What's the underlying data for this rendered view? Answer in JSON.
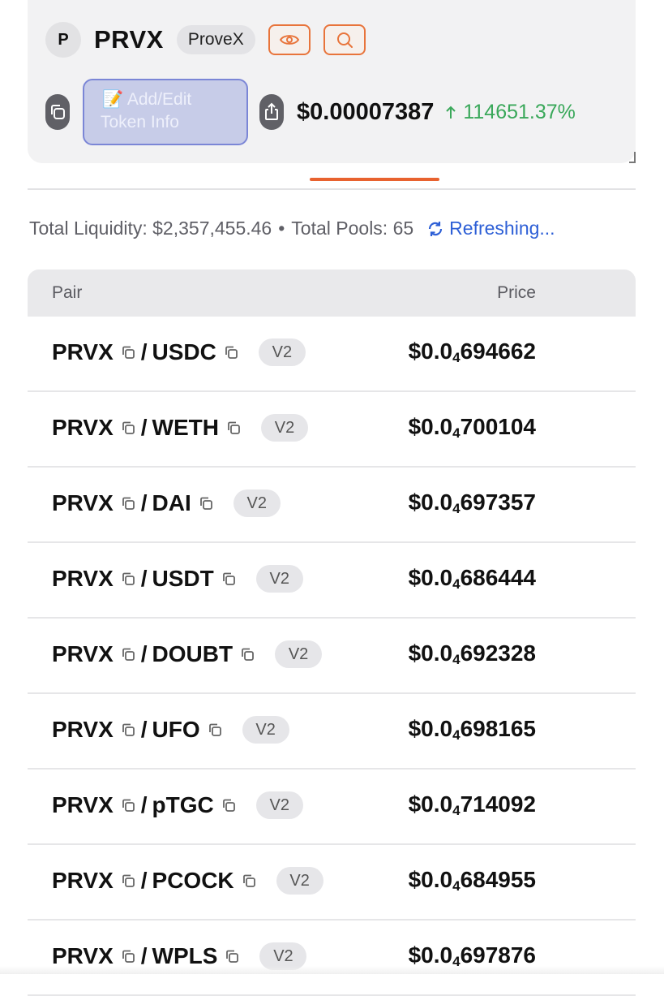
{
  "token": {
    "avatar_letter": "P",
    "symbol": "PRVX",
    "name": "ProveX",
    "add_edit_line1": "📝 Add/Edit",
    "add_edit_line2": "Token Info",
    "price": "$0.00007387",
    "change": "114651.37%",
    "change_color": "#3aa85a"
  },
  "accent": "#e8622f",
  "stats": {
    "liquidity": "Total Liquidity: $2,357,455.46",
    "separator": "•",
    "pools": "Total Pools: 65",
    "refresh": "Refreshing..."
  },
  "table": {
    "headers": {
      "pair": "Pair",
      "price": "Price"
    },
    "rows": [
      {
        "base": "PRVX",
        "slash": "/",
        "quote": "USDC",
        "version": "V2",
        "price_prefix": "$0.0",
        "price_zeros": "4",
        "price_digits": "694662"
      },
      {
        "base": "PRVX",
        "slash": "/",
        "quote": "WETH",
        "version": "V2",
        "price_prefix": "$0.0",
        "price_zeros": "4",
        "price_digits": "700104"
      },
      {
        "base": "PRVX",
        "slash": "/",
        "quote": "DAI",
        "version": "V2",
        "price_prefix": "$0.0",
        "price_zeros": "4",
        "price_digits": "697357"
      },
      {
        "base": "PRVX",
        "slash": "/",
        "quote": "USDT",
        "version": "V2",
        "price_prefix": "$0.0",
        "price_zeros": "4",
        "price_digits": "686444"
      },
      {
        "base": "PRVX",
        "slash": "/",
        "quote": "DOUBT",
        "version": "V2",
        "price_prefix": "$0.0",
        "price_zeros": "4",
        "price_digits": "692328"
      },
      {
        "base": "PRVX",
        "slash": "/",
        "quote": "UFO",
        "version": "V2",
        "price_prefix": "$0.0",
        "price_zeros": "4",
        "price_digits": "698165"
      },
      {
        "base": "PRVX",
        "slash": "/",
        "quote": "pTGC",
        "version": "V2",
        "price_prefix": "$0.0",
        "price_zeros": "4",
        "price_digits": "714092"
      },
      {
        "base": "PRVX",
        "slash": "/",
        "quote": "PCOCK",
        "version": "V2",
        "price_prefix": "$0.0",
        "price_zeros": "4",
        "price_digits": "684955"
      },
      {
        "base": "PRVX",
        "slash": "/",
        "quote": "WPLS",
        "version": "V2",
        "price_prefix": "$0.0",
        "price_zeros": "4",
        "price_digits": "697876"
      }
    ]
  },
  "icons": [
    "eye-icon",
    "search-icon",
    "copy-icon",
    "share-icon",
    "arrow-up-icon",
    "refresh-icon"
  ]
}
